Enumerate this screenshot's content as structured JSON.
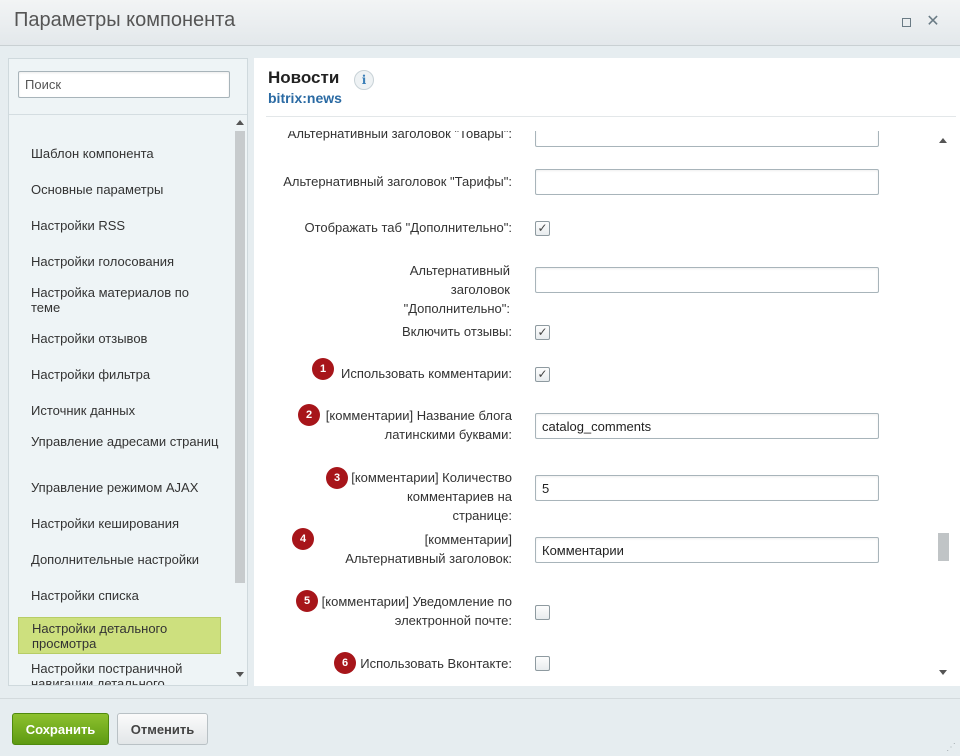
{
  "window": {
    "title": "Параметры компонента"
  },
  "sidebar": {
    "search_placeholder": "Поиск",
    "items": [
      {
        "label": "Шаблон компонента"
      },
      {
        "label": "Основные параметры"
      },
      {
        "label": "Настройки RSS"
      },
      {
        "label": "Настройки голосования"
      },
      {
        "label": "Настройка материалов по теме"
      },
      {
        "label": "Настройки отзывов"
      },
      {
        "label": "Настройки фильтра"
      },
      {
        "label": "Источник данных"
      },
      {
        "label": "Управление адресами страниц"
      },
      {
        "label": "Управление режимом AJAX"
      },
      {
        "label": "Настройки кеширования"
      },
      {
        "label": "Дополнительные настройки"
      },
      {
        "label": "Настройки списка"
      },
      {
        "label": "Настройки детального просмотра",
        "active": true
      },
      {
        "label": "Настройки постраничной навигации детального"
      }
    ]
  },
  "component": {
    "title": "Новости",
    "code": "bitrix:news"
  },
  "params": [
    {
      "label": "Альтернативный заголовок \"Товары\":",
      "type": "text",
      "value": ""
    },
    {
      "label": "Альтернативный заголовок \"Тарифы\":",
      "type": "text",
      "value": ""
    },
    {
      "label": "Отображать таб \"Дополнительно\":",
      "type": "checkbox",
      "checked": true
    },
    {
      "label": "Альтернативный заголовок \"Дополнительно\":",
      "type": "text",
      "value": ""
    },
    {
      "label": "Включить отзывы:",
      "type": "checkbox",
      "checked": true
    },
    {
      "label": "Использовать комментарии:",
      "type": "checkbox",
      "checked": true,
      "badge": "1"
    },
    {
      "label": "[комментарии] Название блога латинскими буквами:",
      "type": "text",
      "value": "catalog_comments",
      "badge": "2"
    },
    {
      "label": "[комментарии] Количество комментариев на странице:",
      "type": "text",
      "value": "5",
      "badge": "3"
    },
    {
      "label": "[комментарии] Альтернативный заголовок:",
      "type": "text",
      "value": "Комментарии",
      "badge": "4"
    },
    {
      "label": "[комментарии] Уведомление по электронной почте:",
      "type": "checkbox",
      "checked": false,
      "badge": "5"
    },
    {
      "label": "Использовать Вконтакте:",
      "type": "checkbox",
      "checked": false,
      "badge": "6"
    }
  ],
  "footer": {
    "save_label": "Сохранить",
    "cancel_label": "Отменить"
  },
  "icons": {
    "check": "✓",
    "info": "i",
    "close": "✕",
    "resize": "⋰"
  },
  "colors": {
    "badge": "#a7151a",
    "save": "#6aa61a",
    "active_item": "#cde07e",
    "link": "#2a6aa3"
  }
}
